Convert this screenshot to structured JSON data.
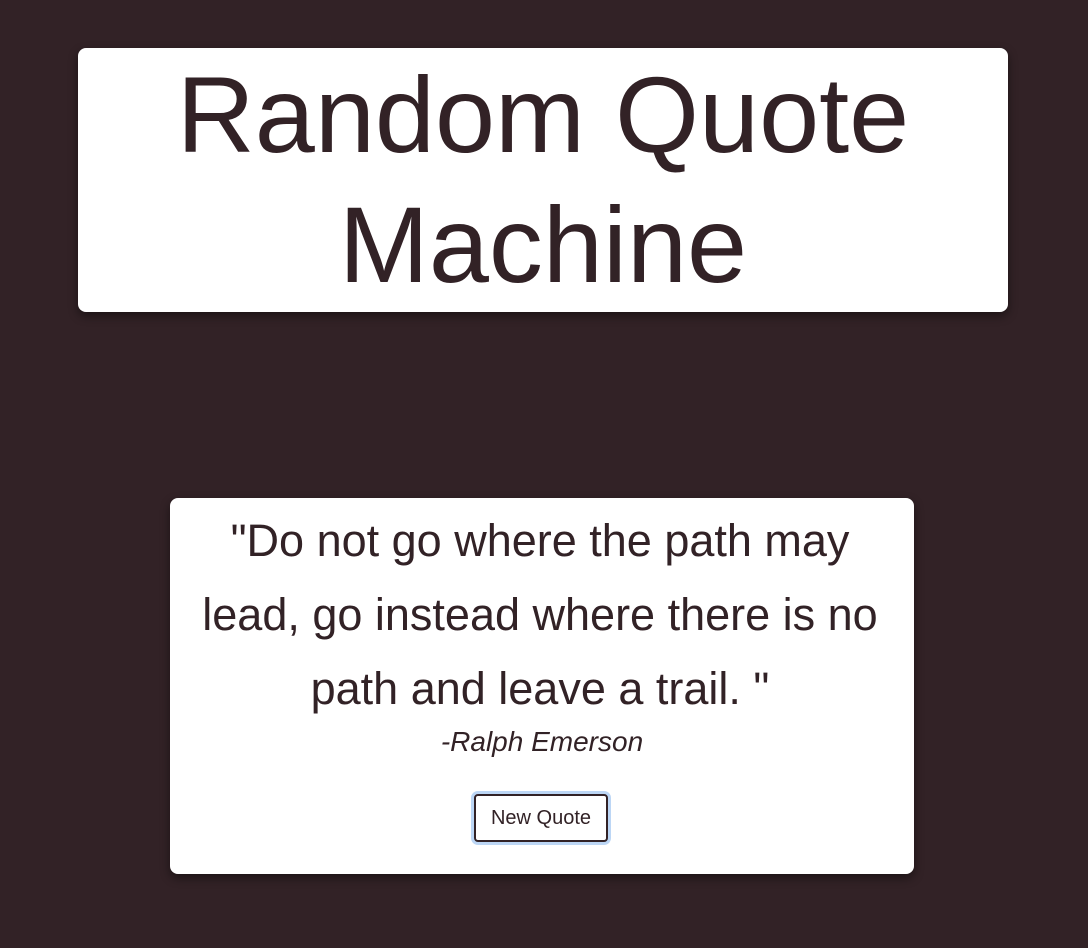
{
  "header": {
    "title": "Random Quote Machine"
  },
  "quote": {
    "text": "\"Do not go where the path may lead, go instead where there is no path and leave a trail. \"",
    "author": "-Ralph Emerson",
    "new_quote_label": "New Quote"
  },
  "colors": {
    "background": "#322226",
    "card": "#ffffff",
    "text": "#322226",
    "button_focus_ring": "#bcd6f5"
  }
}
